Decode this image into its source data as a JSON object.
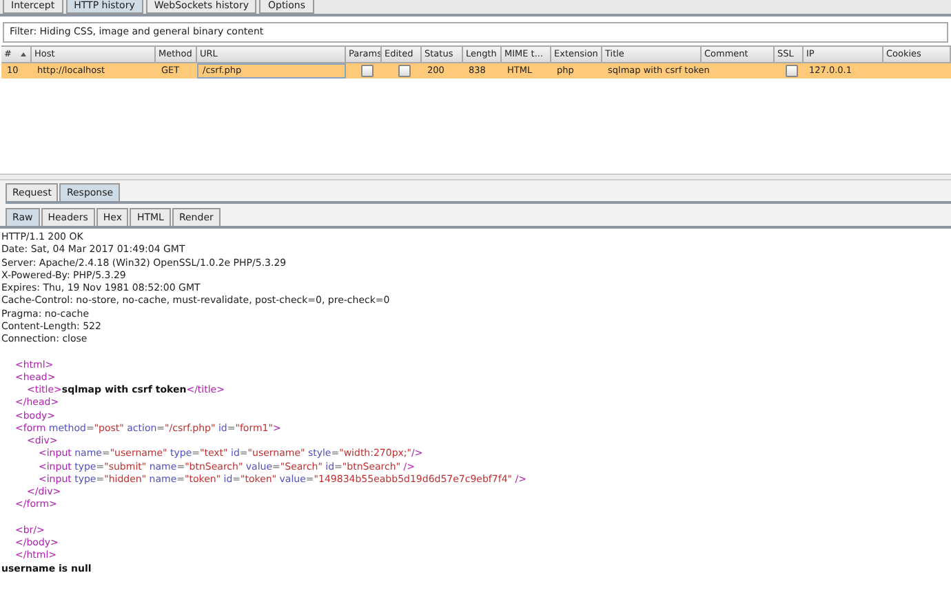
{
  "top_tabs": [
    {
      "label": "Intercept",
      "selected": false
    },
    {
      "label": "HTTP history",
      "selected": true
    },
    {
      "label": "WebSockets history",
      "selected": false
    },
    {
      "label": "Options",
      "selected": false
    }
  ],
  "filter": "Filter: Hiding CSS, image and general binary content",
  "table": {
    "columns": [
      {
        "label": "#",
        "sorted": true
      },
      {
        "label": "Host",
        "sorted": false
      },
      {
        "label": "Method",
        "sorted": false
      },
      {
        "label": "URL",
        "sorted": false
      },
      {
        "label": "Params",
        "sorted": false
      },
      {
        "label": "Edited",
        "sorted": false
      },
      {
        "label": "Status",
        "sorted": false
      },
      {
        "label": "Length",
        "sorted": false
      },
      {
        "label": "MIME t...",
        "sorted": false
      },
      {
        "label": "Extension",
        "sorted": false
      },
      {
        "label": "Title",
        "sorted": false
      },
      {
        "label": "Comment",
        "sorted": false
      },
      {
        "label": "SSL",
        "sorted": false
      },
      {
        "label": "IP",
        "sorted": false
      },
      {
        "label": "Cookies",
        "sorted": false
      }
    ],
    "rows": [
      {
        "selected": true,
        "cells": [
          {
            "kind": "text",
            "text": "10"
          },
          {
            "kind": "text",
            "text": "http://localhost"
          },
          {
            "kind": "text",
            "text": "GET"
          },
          {
            "kind": "focused",
            "text": "/csrf.php"
          },
          {
            "kind": "checkbox",
            "checked": false
          },
          {
            "kind": "checkbox",
            "checked": false
          },
          {
            "kind": "text",
            "text": "200"
          },
          {
            "kind": "text",
            "text": "838"
          },
          {
            "kind": "text",
            "text": "HTML"
          },
          {
            "kind": "text",
            "text": "php"
          },
          {
            "kind": "text",
            "text": "sqlmap with csrf token"
          },
          {
            "kind": "empty"
          },
          {
            "kind": "checkbox",
            "checked": false
          },
          {
            "kind": "text",
            "text": "127.0.0.1"
          },
          {
            "kind": "empty"
          }
        ]
      }
    ]
  },
  "message_tabs": [
    {
      "label": "Request",
      "selected": false
    },
    {
      "label": "Response",
      "selected": true
    }
  ],
  "view_tabs": [
    {
      "label": "Raw",
      "selected": true
    },
    {
      "label": "Headers",
      "selected": false
    },
    {
      "label": "Hex",
      "selected": false
    },
    {
      "label": "HTML",
      "selected": false
    },
    {
      "label": "Render",
      "selected": false
    }
  ],
  "headers": [
    "HTTP/1.1 200 OK",
    "Date: Sat, 04 Mar 2017 01:49:04 GMT",
    "Server: Apache/2.4.18 (Win32) OpenSSL/1.0.2e PHP/5.3.29",
    "X-Powered-By: PHP/5.3.29",
    "Expires: Thu, 19 Nov 1981 08:52:00 GMT",
    "Cache-Control: no-store, no-cache, must-revalidate, post-check=0, pre-check=0",
    "Pragma: no-cache",
    "Content-Length: 522",
    "Connection: close"
  ],
  "markup": [
    {
      "segments": [
        {
          "kind": "tag",
          "text": "<html>"
        }
      ]
    },
    {
      "segments": [
        {
          "kind": "tag",
          "text": "<head>"
        }
      ],
      "children": [
        {
          "segments": [
            {
              "kind": "tag",
              "text": "<title>"
            },
            {
              "kind": "text",
              "text": "sqlmap with csrf token"
            },
            {
              "kind": "tag",
              "text": "</title>"
            }
          ]
        }
      ]
    },
    {
      "segments": [
        {
          "kind": "tag",
          "text": "</head>"
        }
      ]
    },
    {
      "segments": [
        {
          "kind": "tag",
          "text": "<body>"
        }
      ]
    },
    {
      "segments": [
        {
          "kind": "tag",
          "text": "<form"
        },
        {
          "kind": "attr",
          "text": " method"
        },
        {
          "kind": "punct",
          "text": "="
        },
        {
          "kind": "value",
          "text": "\"post\""
        },
        {
          "kind": "attr",
          "text": " action"
        },
        {
          "kind": "punct",
          "text": "="
        },
        {
          "kind": "value",
          "text": "\"/csrf.php\""
        },
        {
          "kind": "attr",
          "text": " id"
        },
        {
          "kind": "punct",
          "text": "="
        },
        {
          "kind": "value",
          "text": "\"form1\""
        },
        {
          "kind": "tag",
          "text": ">"
        }
      ],
      "children": [
        {
          "segments": [
            {
              "kind": "tag",
              "text": "<div>"
            }
          ],
          "children": [
            {
              "segments": [
                {
                  "kind": "tag",
                  "text": "<input"
                },
                {
                  "kind": "attr",
                  "text": " name"
                },
                {
                  "kind": "punct",
                  "text": "="
                },
                {
                  "kind": "value",
                  "text": "\"username\""
                },
                {
                  "kind": "attr",
                  "text": " type"
                },
                {
                  "kind": "punct",
                  "text": "="
                },
                {
                  "kind": "value",
                  "text": "\"text\""
                },
                {
                  "kind": "attr",
                  "text": " id"
                },
                {
                  "kind": "punct",
                  "text": "="
                },
                {
                  "kind": "value",
                  "text": "\"username\""
                },
                {
                  "kind": "attr",
                  "text": " style"
                },
                {
                  "kind": "punct",
                  "text": "="
                },
                {
                  "kind": "value",
                  "text": "\"width:270px;\""
                },
                {
                  "kind": "tag",
                  "text": "/>"
                }
              ]
            },
            {
              "segments": [
                {
                  "kind": "tag",
                  "text": "<input"
                },
                {
                  "kind": "attr",
                  "text": " type"
                },
                {
                  "kind": "punct",
                  "text": "="
                },
                {
                  "kind": "value",
                  "text": "\"submit\""
                },
                {
                  "kind": "attr",
                  "text": " name"
                },
                {
                  "kind": "punct",
                  "text": "="
                },
                {
                  "kind": "value",
                  "text": "\"btnSearch\""
                },
                {
                  "kind": "attr",
                  "text": " value"
                },
                {
                  "kind": "punct",
                  "text": "="
                },
                {
                  "kind": "value",
                  "text": "\"Search\""
                },
                {
                  "kind": "attr",
                  "text": " id"
                },
                {
                  "kind": "punct",
                  "text": "="
                },
                {
                  "kind": "value",
                  "text": "\"btnSearch\""
                },
                {
                  "kind": "tag",
                  "text": " />"
                }
              ]
            },
            {
              "segments": [
                {
                  "kind": "tag",
                  "text": "<input"
                },
                {
                  "kind": "attr",
                  "text": " type"
                },
                {
                  "kind": "punct",
                  "text": "="
                },
                {
                  "kind": "value",
                  "text": "\"hidden\""
                },
                {
                  "kind": "attr",
                  "text": " name"
                },
                {
                  "kind": "punct",
                  "text": "="
                },
                {
                  "kind": "value",
                  "text": "\"token\""
                },
                {
                  "kind": "attr",
                  "text": " id"
                },
                {
                  "kind": "punct",
                  "text": "="
                },
                {
                  "kind": "value",
                  "text": "\"token\""
                },
                {
                  "kind": "attr",
                  "text": " value"
                },
                {
                  "kind": "punct",
                  "text": "="
                },
                {
                  "kind": "value",
                  "text": "\"149834b55eabb5d19d6d57e7c9ebf7f4\""
                },
                {
                  "kind": "tag",
                  "text": " />"
                }
              ]
            }
          ]
        },
        {
          "segments": [
            {
              "kind": "tag",
              "text": "</div>"
            }
          ]
        }
      ]
    },
    {
      "segments": [
        {
          "kind": "tag",
          "text": "</form>"
        }
      ]
    },
    {
      "kind": "blank"
    },
    {
      "segments": [
        {
          "kind": "tag",
          "text": "<br/>"
        }
      ]
    },
    {
      "segments": [
        {
          "kind": "tag",
          "text": "</body>"
        }
      ]
    },
    {
      "segments": [
        {
          "kind": "tag",
          "text": "</html>"
        }
      ]
    }
  ],
  "output": "username is null"
}
